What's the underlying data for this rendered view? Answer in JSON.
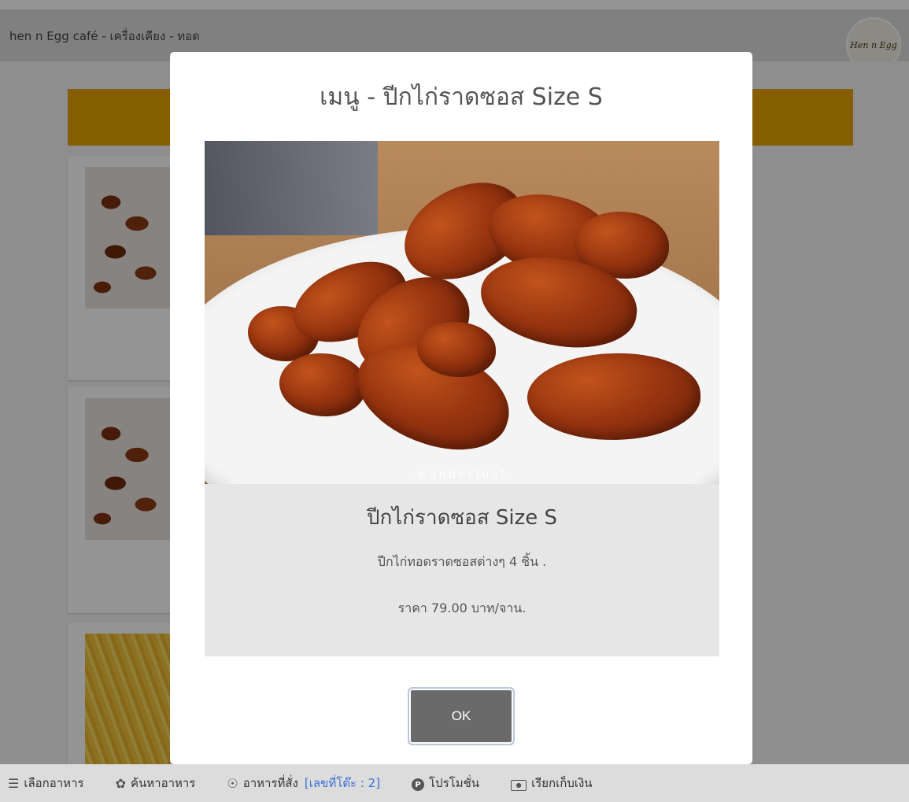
{
  "header": {
    "title": "hen n Egg café - เครื่องเคียง - ทอด",
    "logo_text": "Hen n Egg"
  },
  "modal": {
    "title": "เมนู - ปีกไก่ราดซอส Size S",
    "photo_watermark": ".wanderlust.",
    "item_name": "ปีกไก่ราดซอส Size S",
    "item_description": "ปีกไก่ทอดราดซอสต่างๆ 4 ชิ้น .",
    "item_price": "ราคา 79.00 บาท/จาน.",
    "ok_label": "OK"
  },
  "bottom_nav": {
    "items": [
      {
        "label": "เลือกอาหาร",
        "icon": "menu-icon"
      },
      {
        "label": "ค้นหาอาหาร",
        "icon": "leaf-icon"
      },
      {
        "label": "อาหารที่สั่ง",
        "icon": "dish-icon",
        "extra": "[เลขที่โต๊ะ : 2]"
      },
      {
        "label": "โปรโมชั่น",
        "icon": "promotion-icon"
      },
      {
        "label": "เรียกเก็บเงิน",
        "icon": "money-icon"
      }
    ]
  },
  "colors": {
    "category_banner": "#e6a300",
    "table_number": "#3a6fd8",
    "ok_button": "#6a6a6a"
  }
}
